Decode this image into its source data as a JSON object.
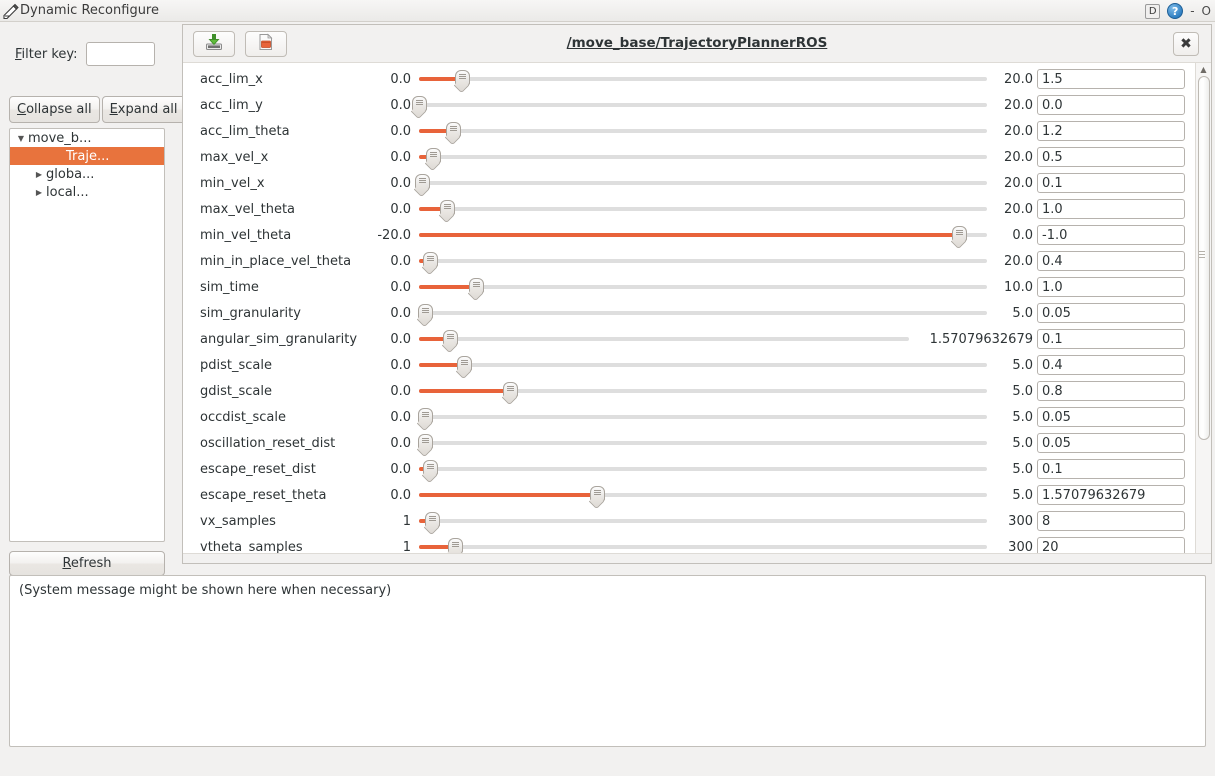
{
  "window": {
    "title": "Dynamic Reconfigure",
    "app_icon": "pencil-edit-icon",
    "controls": {
      "dock_label": "D",
      "help_icon": "help-question-icon",
      "minimize_glyph": "-",
      "maximize_glyph": "O"
    }
  },
  "sidebar": {
    "filter_label": "Filter key:",
    "filter_value": "",
    "filter_placeholder": "",
    "collapse_all_label": "Collapse all",
    "expand_all_label": "Expand all",
    "refresh_label": "Refresh",
    "tree": [
      {
        "label": "move_b...",
        "indent": 0,
        "expander": "▼",
        "selected": false
      },
      {
        "label": "Traje...",
        "indent": 1,
        "expander": "",
        "selected": true
      },
      {
        "label": "globa...",
        "indent": 1,
        "expander": "▶",
        "selected": false
      },
      {
        "label": "local...",
        "indent": 1,
        "expander": "▶",
        "selected": false
      }
    ]
  },
  "toolbar": {
    "save_icon": "save-download-icon",
    "open_icon": "open-folder-icon",
    "node_title": "/move_base/TrajectoryPlannerROS",
    "close_label": "✖"
  },
  "colors": {
    "accent_orange": "#e8633a",
    "selection_orange": "#e8733d",
    "track_grey": "#dedede",
    "window_bg": "#f2f1f0"
  },
  "params": [
    {
      "name": "acc_lim_x",
      "min": "0.0",
      "max": "20.0",
      "value": "1.5",
      "pct": 7.5
    },
    {
      "name": "acc_lim_y",
      "min": "0.0",
      "max": "20.0",
      "value": "0.0",
      "pct": 0.0
    },
    {
      "name": "acc_lim_theta",
      "min": "0.0",
      "max": "20.0",
      "value": "1.2",
      "pct": 6.0
    },
    {
      "name": "max_vel_x",
      "min": "0.0",
      "max": "20.0",
      "value": "0.5",
      "pct": 2.5
    },
    {
      "name": "min_vel_x",
      "min": "0.0",
      "max": "20.0",
      "value": "0.1",
      "pct": 0.5
    },
    {
      "name": "max_vel_theta",
      "min": "0.0",
      "max": "20.0",
      "value": "1.0",
      "pct": 5.0
    },
    {
      "name": "min_vel_theta",
      "min": "-20.0",
      "max": "0.0",
      "value": "-1.0",
      "pct": 95.0
    },
    {
      "name": "min_in_place_vel_theta",
      "min": "0.0",
      "max": "20.0",
      "value": "0.4",
      "pct": 2.0
    },
    {
      "name": "sim_time",
      "min": "0.0",
      "max": "10.0",
      "value": "1.0",
      "pct": 10.0
    },
    {
      "name": "sim_granularity",
      "min": "0.0",
      "max": "5.0",
      "value": "0.05",
      "pct": 1.0
    },
    {
      "name": "angular_sim_granularity",
      "min": "0.0",
      "max": "1.57079632679",
      "value": "0.1",
      "pct": 6.4
    },
    {
      "name": "pdist_scale",
      "min": "0.0",
      "max": "5.0",
      "value": "0.4",
      "pct": 8.0
    },
    {
      "name": "gdist_scale",
      "min": "0.0",
      "max": "5.0",
      "value": "0.8",
      "pct": 16.0
    },
    {
      "name": "occdist_scale",
      "min": "0.0",
      "max": "5.0",
      "value": "0.05",
      "pct": 1.0
    },
    {
      "name": "oscillation_reset_dist",
      "min": "0.0",
      "max": "5.0",
      "value": "0.05",
      "pct": 1.0
    },
    {
      "name": "escape_reset_dist",
      "min": "0.0",
      "max": "5.0",
      "value": "0.1",
      "pct": 2.0
    },
    {
      "name": "escape_reset_theta",
      "min": "0.0",
      "max": "5.0",
      "value": "1.57079632679",
      "pct": 31.4
    },
    {
      "name": "vx_samples",
      "min": "1",
      "max": "300",
      "value": "8",
      "pct": 2.3
    },
    {
      "name": "vtheta_samples",
      "min": "1",
      "max": "300",
      "value": "20",
      "pct": 6.4
    }
  ],
  "console": {
    "message": "(System message might be shown here when necessary)"
  }
}
